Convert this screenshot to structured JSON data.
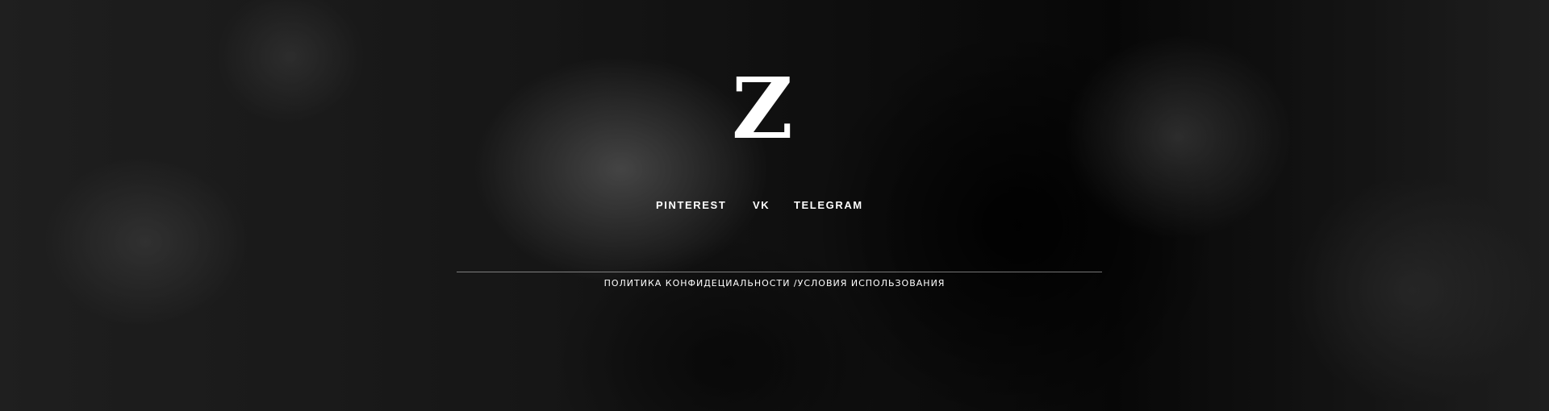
{
  "footer": {
    "logo": "Z",
    "social": {
      "pinterest": "PINTEREST",
      "vk": "VK",
      "telegram": "TELEGRAM"
    },
    "legal": {
      "privacy": "ПОЛИТИКА КОНФИДЕЦИАЛЬНОСТИ",
      "separator": " /",
      "terms": "УСЛОВИЯ ИСПОЛЬЗОВАНИЯ"
    }
  }
}
